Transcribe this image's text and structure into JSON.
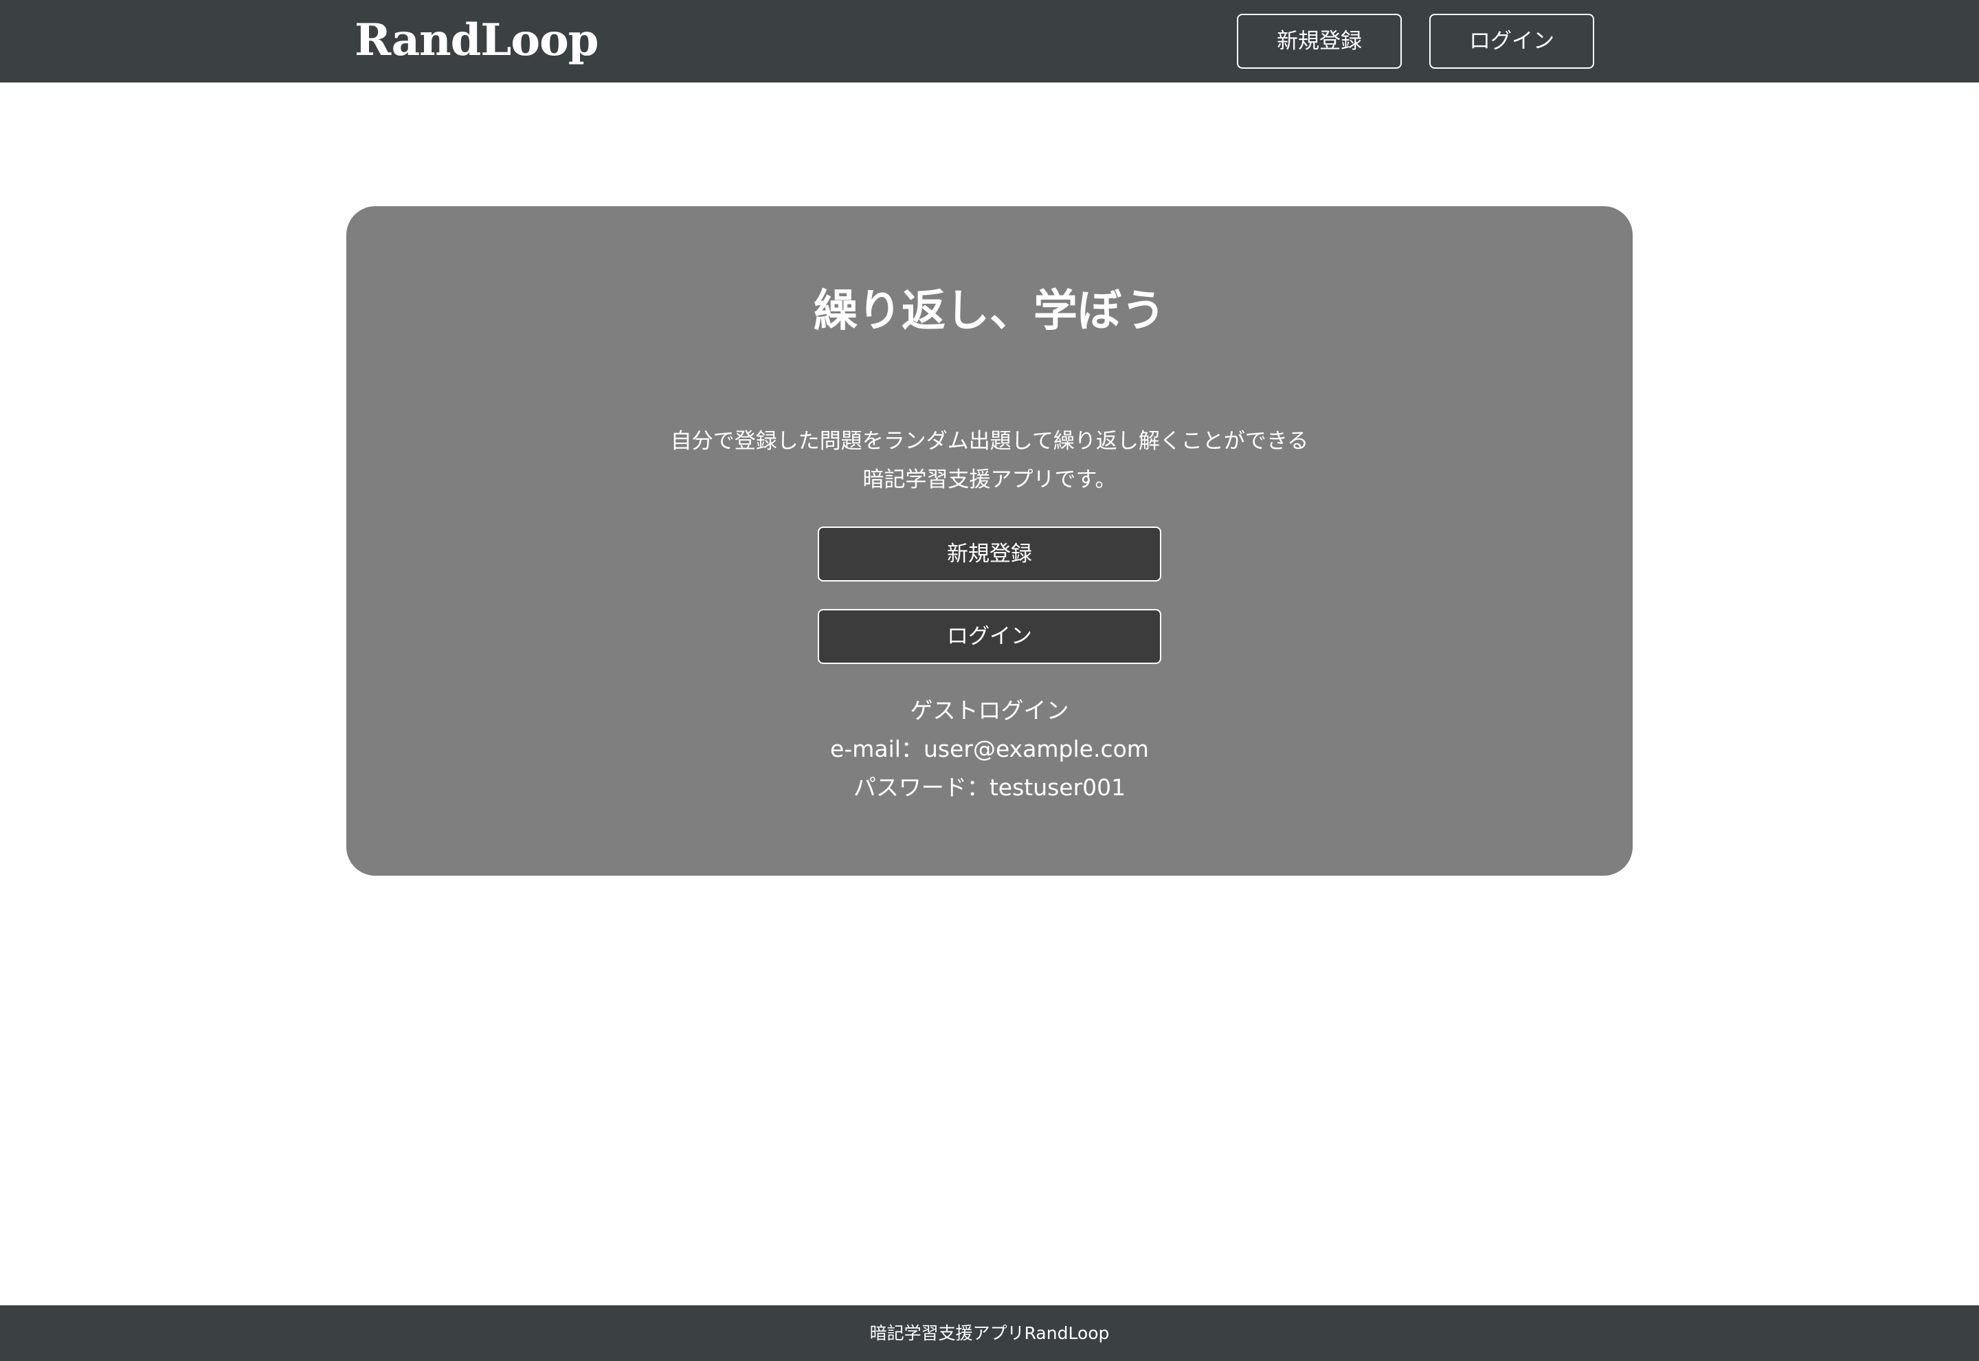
{
  "header": {
    "logo": "RandLoop",
    "signup_label": "新規登録",
    "login_label": "ログイン"
  },
  "hero": {
    "title": "繰り返し、学ぼう",
    "description_line1": "自分で登録した問題をランダム出題して繰り返し解くことができる",
    "description_line2": "暗記学習支援アプリです。",
    "signup_label": "新規登録",
    "login_label": "ログイン",
    "guest_title": "ゲストログイン",
    "guest_email": "e-mail：user@example.com",
    "guest_password": "パスワード：testuser001"
  },
  "footer": {
    "text": "暗記学習支援アプリRandLoop"
  },
  "colors": {
    "header_bg": "#3b4043",
    "hero_bg": "#7f7f7f",
    "button_bg": "#3c3c3c",
    "text": "#ffffff"
  }
}
